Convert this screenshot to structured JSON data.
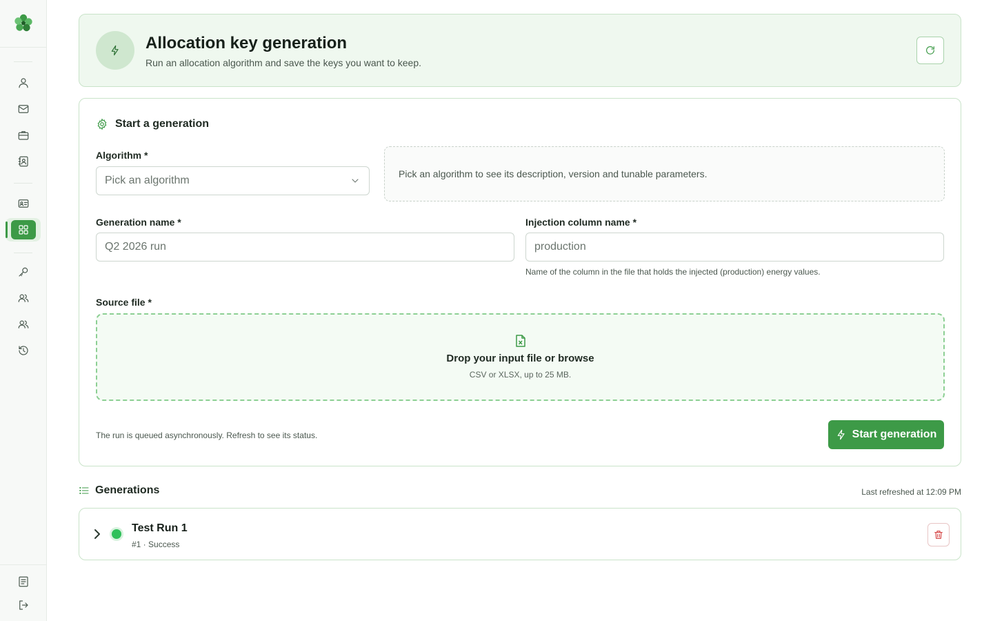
{
  "colors": {
    "accent": "#3d9a47",
    "success": "#2fc05a",
    "danger": "#d23b3b",
    "header_bg": "#eff8ef"
  },
  "sidebar": {
    "logo_icon": "clover-logo-icon",
    "items": [
      {
        "icon": "user-icon"
      },
      {
        "icon": "mail-icon"
      },
      {
        "icon": "briefcase-icon"
      },
      {
        "icon": "contact-book-icon"
      },
      {
        "icon": "id-card-icon"
      },
      {
        "icon": "grid-icon",
        "active": true
      },
      {
        "icon": "key-icon"
      },
      {
        "icon": "users-icon"
      },
      {
        "icon": "users-group-icon"
      },
      {
        "icon": "history-icon"
      },
      {
        "icon": "document-icon"
      },
      {
        "icon": "logout-icon"
      }
    ]
  },
  "header": {
    "icon": "bolt-icon",
    "title": "Allocation key generation",
    "subtitle": "Run an allocation algorithm and save the keys you want to keep.",
    "refresh_icon": "refresh-icon"
  },
  "form": {
    "section_title": "Start a generation",
    "algorithm": {
      "label": "Algorithm *",
      "placeholder": "Pick an algorithm"
    },
    "algorithm_hint": "Pick an algorithm to see its description, version and tunable parameters.",
    "generation_name": {
      "label": "Generation name *",
      "placeholder": "Q2 2026 run"
    },
    "injection_column": {
      "label": "Injection column name *",
      "value": "production",
      "help": "Name of the column in the file that holds the injected (production) energy values."
    },
    "source_file": {
      "label": "Source file *",
      "title": "Drop your input file or browse",
      "subtitle": "CSV or XLSX, up to 25 MB."
    },
    "queue_note": "The run is queued asynchronously. Refresh to see its status.",
    "start_label": "Start generation"
  },
  "generations": {
    "title": "Generations",
    "last_refreshed": "Last refreshed at 12:09 PM",
    "rows": [
      {
        "name": "Test Run 1",
        "meta": "#1 · Success",
        "status": "success"
      }
    ]
  }
}
